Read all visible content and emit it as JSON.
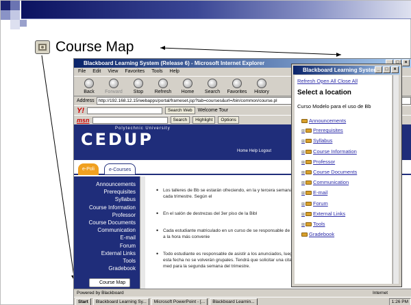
{
  "slide": {
    "title": "Course Map",
    "icon": "course-map-icon"
  },
  "browser": {
    "window_title": "Blackboard Learning System (Release 6) - Microsoft Internet Explorer",
    "menu": [
      "File",
      "Edit",
      "View",
      "Favorites",
      "Tools",
      "Help"
    ],
    "toolbar": [
      "Back",
      "Forward",
      "Stop",
      "Refresh",
      "Home",
      "Search",
      "Favorites",
      "History"
    ],
    "address_label": "Address",
    "address_value": "http://192.168.12.15/webapps/portal/frameset.jsp?tab=courses&url=/bin/common/course.pl",
    "yahoo_search_button": "Search Web",
    "yahoo_welcome": "Welcome Tour",
    "msn_search": "Search",
    "msn_highlight": "Highlight",
    "msn_options": "Options",
    "status": "Powered by Blackboard",
    "status_zone": "Internet"
  },
  "site": {
    "subtitle": "Polytechnic University",
    "logo": "CEDUP",
    "header_links": "Home   Help   Logout",
    "tabs": [
      "e-Poli",
      "e-Courses"
    ],
    "nav": [
      "Announcements",
      "Prerequisites",
      "Syllabus",
      "Course Information",
      "Professor",
      "Course Documents",
      "Communication",
      "E-mail",
      "Forum",
      "External Links",
      "Tools",
      "Gradebook"
    ],
    "course_map_button": "Course Map",
    "bullets": [
      "Los talleres de Bb se estarán ofreciendo, en la y tercera semana de cada trimestre. Según el",
      "En el salón de destrezas del 3er piso de la Bibl",
      "Cada estudiante matriculado en un curso de se responsable de tomarlo a la hora más convenie",
      "Todo estudiante es responsable de asistir a los anunciados, luego de esta fecha no se volverán grupales. Tendrá que solicitar una cita por med para la segunda semana del trimestre."
    ]
  },
  "popup": {
    "window_title": "Blackboard Learning System...",
    "links": [
      "Refresh",
      "Open All",
      "Close All"
    ],
    "heading": "Select a location",
    "course_title": "Curso Modelo para el uso de Bb",
    "tree": [
      "Announcements",
      "Prerequisites",
      "Syllabus",
      "Course Information",
      "Professor",
      "Course Documents",
      "Communication",
      "E-mail",
      "Forum",
      "External Links",
      "Tools",
      "Gradebook"
    ]
  },
  "taskbar": {
    "start": "Start",
    "tasks": [
      "Blackboard Learning Sy...",
      "Microsoft PowerPoint - [...",
      "Blackboard Learnin..."
    ],
    "clock": "1:26 PM"
  },
  "colors": {
    "header_blue": "#1f2d7a",
    "tab_epoli": "#f0a020",
    "link_blue": "#2a2aa8"
  }
}
